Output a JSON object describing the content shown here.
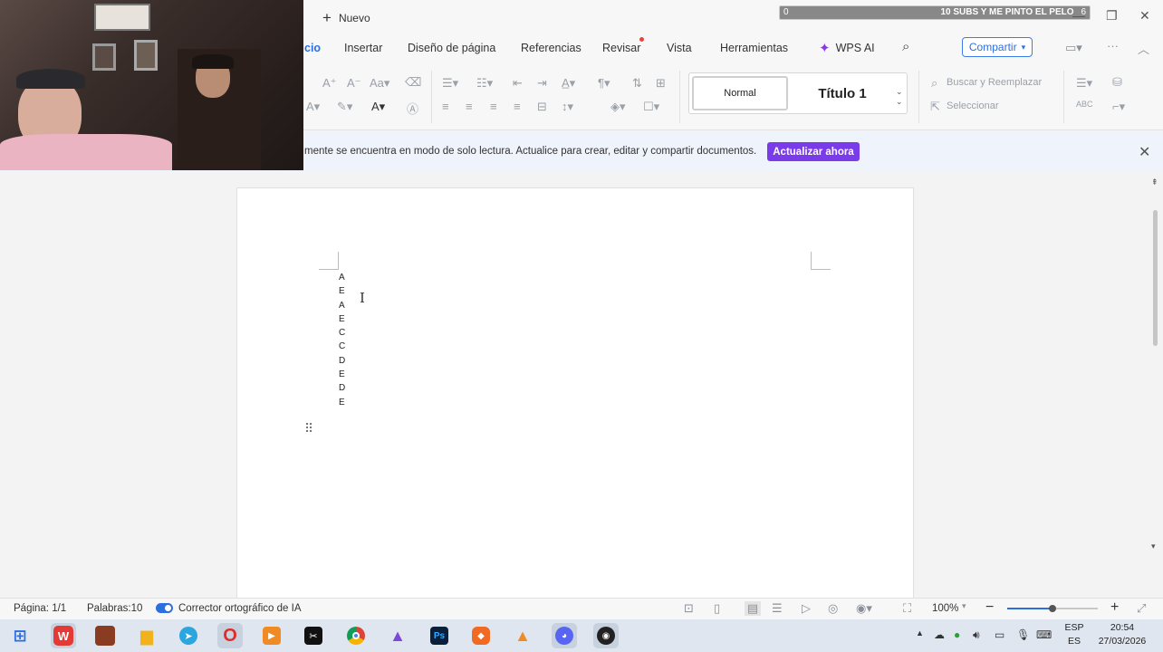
{
  "titlebar": {
    "new_tab": "Nuevo",
    "subs_goal": {
      "low": "0",
      "high": "6",
      "label": "10 SUBS Y ME PINTO EL PELO",
      "progress": 0.0
    },
    "behind_label": "Actualizar ahora"
  },
  "ribbon": {
    "tabs": [
      "cio",
      "Insertar",
      "Diseño de página",
      "Referencias",
      "Revisar",
      "Vista",
      "Herramientas"
    ],
    "wps_ai": "WPS AI",
    "share": "Compartir"
  },
  "styles": {
    "normal": "Normal",
    "title": "Título 1"
  },
  "side_tools": {
    "find_replace": "Buscar y Reemplazar",
    "select": "Seleccionar"
  },
  "notice": {
    "text": "mente se encuentra en modo de solo lectura. Actualice para crear, editar y compartir documentos.",
    "button": "Actualizar ahora"
  },
  "document": {
    "lines": [
      "A",
      "E",
      "A",
      "E",
      "C",
      "C",
      "D",
      "E",
      "D",
      "E"
    ]
  },
  "status": {
    "page": "Página: 1/1",
    "words": "Palabras:10",
    "spellcheck": "Corrector ortográfico de IA",
    "zoom": "100%",
    "zoom_level": 0.5
  },
  "taskbar": {
    "apps": [
      "windows-start",
      "wps-office",
      "game-app",
      "file-explorer",
      "telegram",
      "opera",
      "media-player",
      "capcut",
      "chrome",
      "app-triangle",
      "photoshop",
      "brave",
      "vlc",
      "discord",
      "obs"
    ],
    "lang_top": "ESP",
    "lang_bottom": "ES",
    "time": "20:54",
    "date": "27/03/2026"
  }
}
